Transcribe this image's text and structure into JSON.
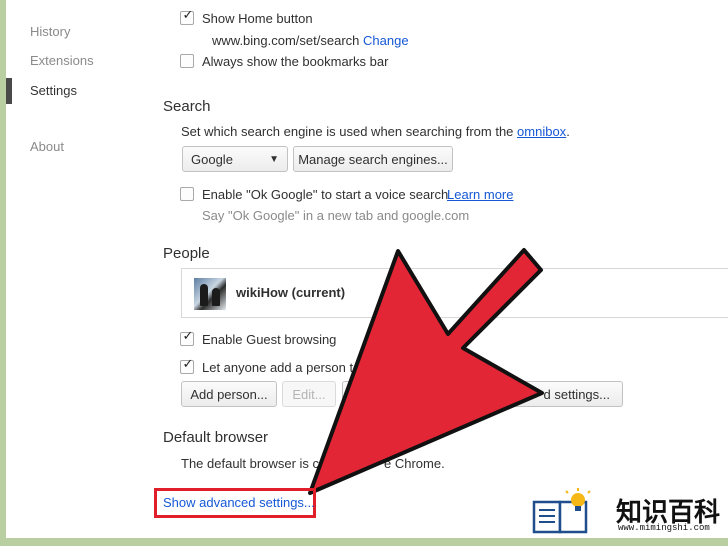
{
  "sidebar": {
    "items": [
      {
        "label": "History"
      },
      {
        "label": "Extensions"
      },
      {
        "label": "Settings"
      },
      {
        "label": "About"
      }
    ]
  },
  "appearance": {
    "show_home_button": {
      "label": "Show Home button",
      "checked": true
    },
    "home_url": "www.bing.com/set/search",
    "change_link": "Change",
    "show_bookmarks_bar": {
      "label": "Always show the bookmarks bar",
      "checked": false
    }
  },
  "search": {
    "heading": "Search",
    "description": "Set which search engine is used when searching from the",
    "omnibox_link": "omnibox",
    "period": ".",
    "engine_select": "Google",
    "manage_button": "Manage search engines...",
    "ok_google": {
      "label": "Enable \"Ok Google\" to start a voice search",
      "checked": false
    },
    "learn_more": "Learn more",
    "ok_google_sub": "Say \"Ok Google\" in a new tab and google.com"
  },
  "people": {
    "heading": "People",
    "profile_name": "wikiHow (current)",
    "guest_browsing": {
      "label": "Enable Guest browsing",
      "checked": true
    },
    "add_person_option": {
      "label": "Let anyone add a person to",
      "checked": true
    },
    "add_person_button": "Add person...",
    "edit_button": "Edit...",
    "import_button": "d settings..."
  },
  "default_browser": {
    "heading": "Default browser",
    "text": "The default browser is cu",
    "text_end": "e Chrome."
  },
  "advanced_link": "Show advanced settings...",
  "watermark": {
    "title": "知识百科",
    "url": "www.mimingshi.com"
  },
  "colors": {
    "arrow": "#e32636",
    "link": "#1558d6",
    "frame_bg": "#b9cfa1"
  }
}
